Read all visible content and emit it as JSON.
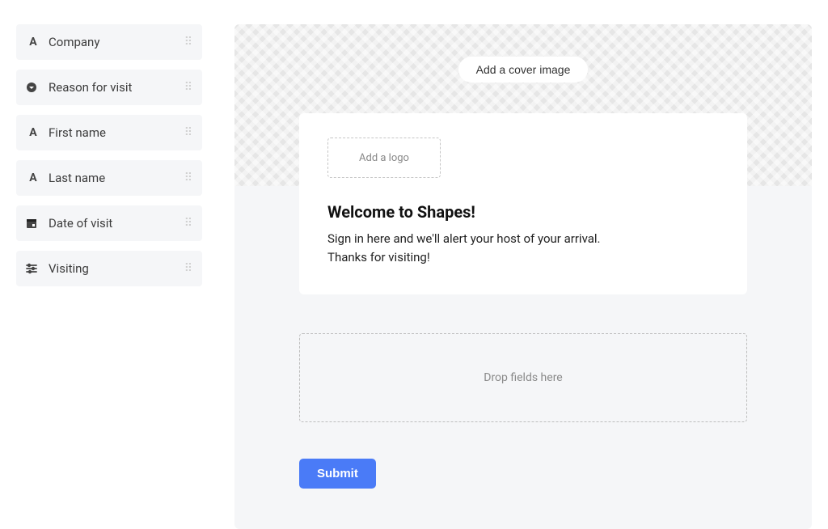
{
  "sidebar": {
    "items": [
      {
        "label": "Company",
        "icon": "text-icon"
      },
      {
        "label": "Reason for visit",
        "icon": "dropdown-icon"
      },
      {
        "label": "First name",
        "icon": "text-icon"
      },
      {
        "label": "Last name",
        "icon": "text-icon"
      },
      {
        "label": "Date of visit",
        "icon": "calendar-icon"
      },
      {
        "label": "Visiting",
        "icon": "settings-icon"
      }
    ]
  },
  "cover": {
    "add_image_label": "Add a cover image"
  },
  "card": {
    "add_logo_label": "Add a logo",
    "title": "Welcome to Shapes!",
    "body_line1": "Sign in here and we'll alert your host of your arrival.",
    "body_line2": "Thanks for visiting!"
  },
  "drop_zone": {
    "label": "Drop fields here"
  },
  "submit": {
    "label": "Submit"
  }
}
